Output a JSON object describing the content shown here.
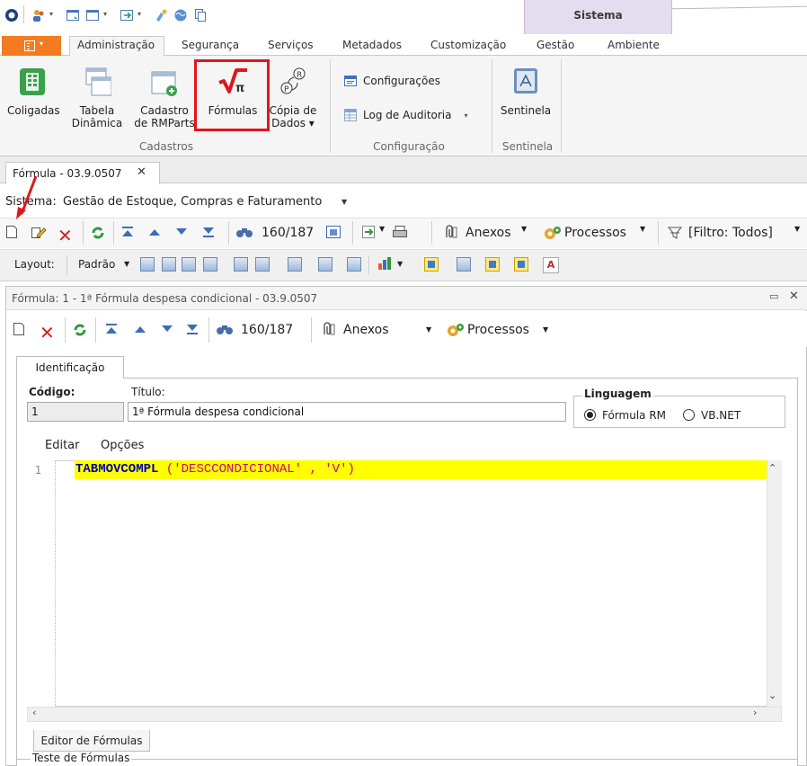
{
  "ribbon": {
    "context_tab_label": "Sistema",
    "tabs": [
      {
        "label": "Administração",
        "active": true
      },
      {
        "label": "Segurança"
      },
      {
        "label": "Serviços"
      },
      {
        "label": "Metadados"
      },
      {
        "label": "Customização"
      },
      {
        "label": "Gestão"
      },
      {
        "label": "Ambiente"
      }
    ],
    "buttons": {
      "coligadas": "Coligadas",
      "tabela_l1": "Tabela",
      "tabela_l2": "Dinâmica",
      "cadastro_l1": "Cadastro",
      "cadastro_l2": "de RMParts",
      "formulas": "Fórmulas",
      "copia_l1": "Cópia de",
      "copia_l2": "Dados ▾",
      "configuracoes": "Configurações",
      "log_auditoria": "Log de Auditoria",
      "sentinela": "Sentinela"
    },
    "groups": {
      "cadastros": "Cadastros",
      "configuracao": "Configuração",
      "sentinela": "Sentinela"
    },
    "highlight_color": "#e0161d",
    "file_tab_color": "#f47b20"
  },
  "document_tab": {
    "label": "Fórmula - 03.9.0507",
    "close": "✕"
  },
  "system": {
    "label": "Sistema:",
    "value": "Gestão de Estoque, Compras e Faturamento"
  },
  "toolbar": {
    "record_counter": "160/187",
    "anexos": "Anexos",
    "processos": "Processos",
    "filtro": "[Filtro: Todos]"
  },
  "layout_toolbar": {
    "layout_label": "Layout:",
    "padrao": "Padrão"
  },
  "form_window": {
    "title": "Fórmula: 1 - 1ª Fórmula despesa condicional - 03.9.0507",
    "record_counter": "160/187",
    "anexos": "Anexos",
    "processos": "Processos",
    "tab_identificacao": "Identificação",
    "codigo_label": "Código:",
    "codigo_value": "1",
    "titulo_label": "Título:",
    "titulo_value": "1ª Fórmula despesa condicional",
    "linguagem_label": "Linguagem",
    "lang_options": [
      {
        "label": "Fórmula RM",
        "selected": true
      },
      {
        "label": "VB.NET",
        "selected": false
      }
    ],
    "menu": [
      "Editar",
      "Opções"
    ],
    "editor": {
      "line_number": "1",
      "code_keyword": "TABMOVCOMPL",
      "code_open": " (",
      "code_arg1": "'DESCCONDICIONAL'",
      "code_comma": " , ",
      "code_arg2": "'V'",
      "code_close": ")"
    },
    "bottom_tab": "Editor de Fórmulas",
    "test_group": "Teste de Fórmulas"
  }
}
